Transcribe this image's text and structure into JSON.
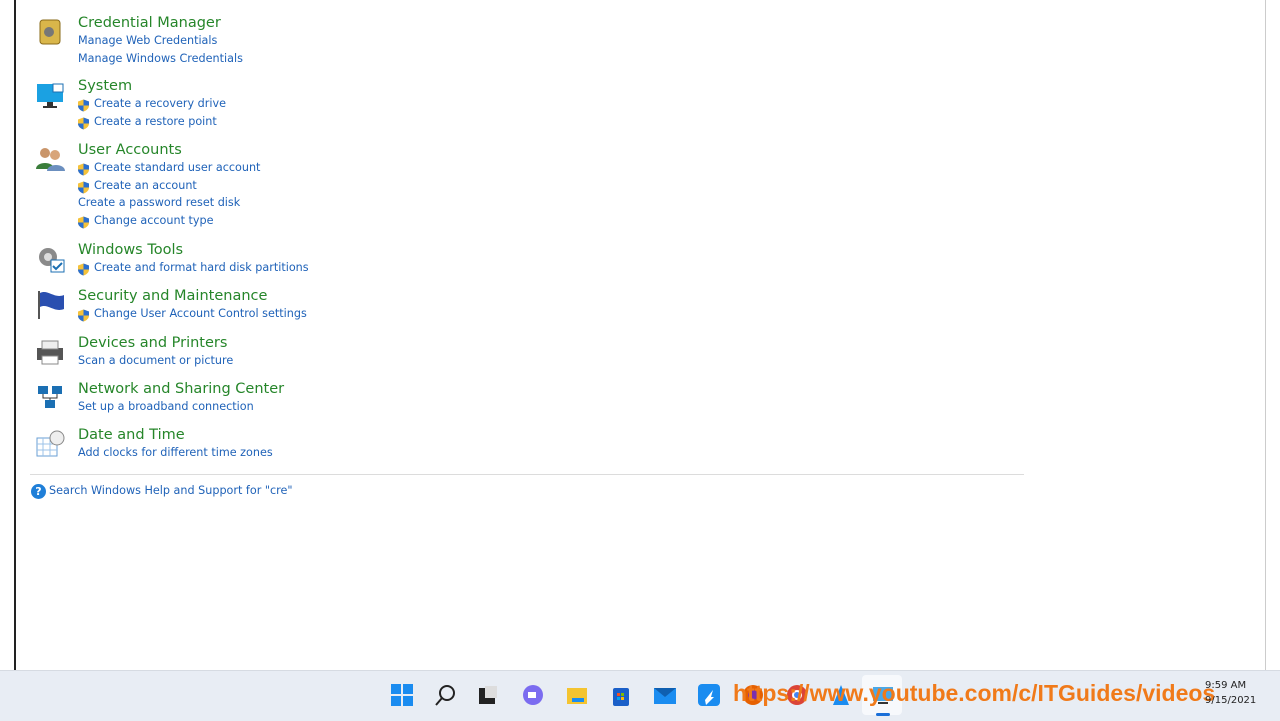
{
  "categories": [
    {
      "title": "Credential Manager",
      "icon": "credential-vault-icon",
      "links": [
        {
          "label": "Manage Web Credentials",
          "shield": false
        },
        {
          "label": "Manage Windows Credentials",
          "shield": false
        }
      ]
    },
    {
      "title": "System",
      "icon": "monitor-icon",
      "links": [
        {
          "label": "Create a recovery drive",
          "shield": true
        },
        {
          "label": "Create a restore point",
          "shield": true
        }
      ]
    },
    {
      "title": "User Accounts",
      "icon": "users-icon",
      "links": [
        {
          "label": "Create standard user account",
          "shield": true
        },
        {
          "label": "Create an account",
          "shield": true
        },
        {
          "label": "Create a password reset disk",
          "shield": false
        },
        {
          "label": "Change account type",
          "shield": true
        }
      ]
    },
    {
      "title": "Windows Tools",
      "icon": "gear-icon",
      "links": [
        {
          "label": "Create and format hard disk partitions",
          "shield": true
        }
      ]
    },
    {
      "title": "Security and Maintenance",
      "icon": "flag-icon",
      "links": [
        {
          "label": "Change User Account Control settings",
          "shield": true
        }
      ]
    },
    {
      "title": "Devices and Printers",
      "icon": "printer-icon",
      "links": [
        {
          "label": "Scan a document or picture",
          "shield": false
        }
      ]
    },
    {
      "title": "Network and Sharing Center",
      "icon": "network-icon",
      "links": [
        {
          "label": "Set up a broadband connection",
          "shield": false
        }
      ]
    },
    {
      "title": "Date and Time",
      "icon": "calendar-clock-icon",
      "links": [
        {
          "label": "Add clocks for different time zones",
          "shield": false
        }
      ]
    }
  ],
  "help_link": "Search Windows Help and Support for \"cre\"",
  "taskbar": {
    "items": [
      "start",
      "search",
      "task-view",
      "chat",
      "file-explorer",
      "store",
      "mail",
      "app",
      "firefox",
      "chrome",
      "paint",
      "control-panel"
    ],
    "time": "9:59 AM",
    "date": "9/15/2021"
  },
  "watermark": "https://www.youtube.com/c/ITGuides/videos",
  "colors": {
    "title": "#26862a",
    "link": "#1f62b8",
    "watermark": "#f07a1a"
  }
}
